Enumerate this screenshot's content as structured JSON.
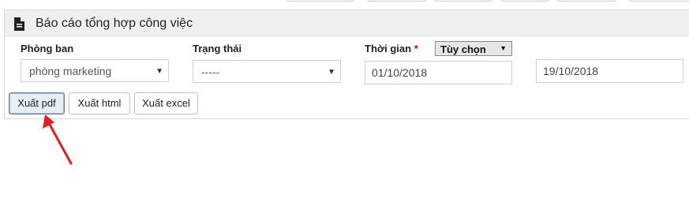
{
  "header": {
    "title": "Báo cáo tổng hợp công việc",
    "icon": "document-icon"
  },
  "filters": {
    "department": {
      "label": "Phòng ban",
      "value": "phòng marketing"
    },
    "status": {
      "label": "Trạng thái",
      "value": "-----"
    },
    "time": {
      "label": "Thời gian",
      "required_mark": "*",
      "mode": "Tùy chọn",
      "from": "01/10/2018",
      "to": "19/10/2018"
    }
  },
  "actions": {
    "pdf": "Xuất pdf",
    "html": "Xuất html",
    "excel": "Xuất excel"
  },
  "colors": {
    "arrow": "#e02020",
    "header_bg": "#efefef"
  }
}
